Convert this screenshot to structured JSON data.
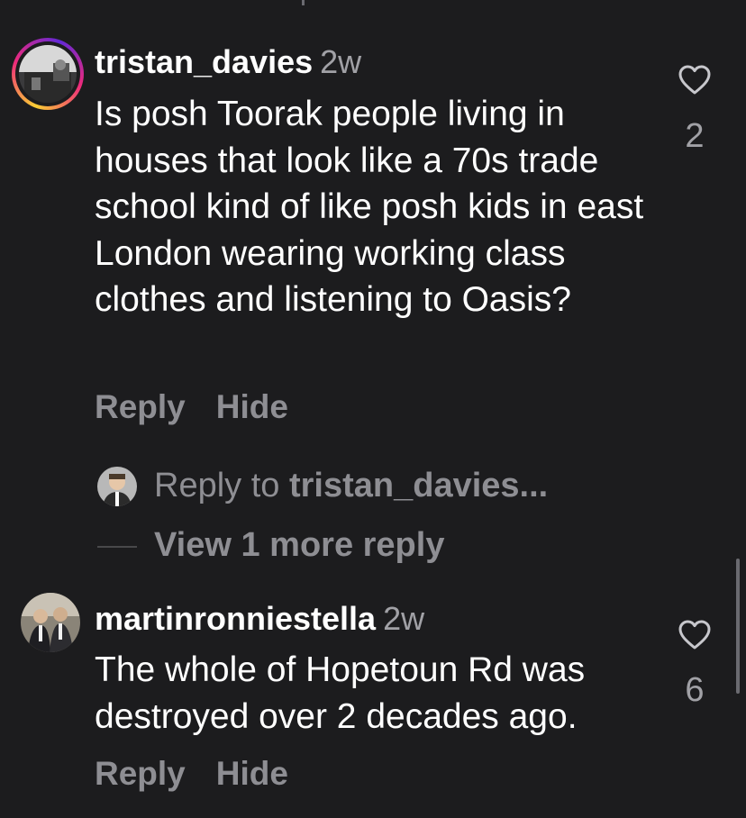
{
  "comments": [
    {
      "username": "tristan_davies",
      "time": "2w",
      "text": "Is posh Toorak people living in houses that look like a 70s trade school kind of like posh kids in east London wearing working class clothes and listening to Oasis?",
      "likes": "2",
      "actions": {
        "reply": "Reply",
        "hide": "Hide"
      },
      "replies": {
        "reply_prefix": "Reply to ",
        "reply_target": "tristan_davies...",
        "view_more": "View 1 more reply"
      }
    },
    {
      "username": "martinronniestella",
      "time": "2w",
      "text": "The whole of Hopetoun Rd was destroyed over 2 decades ago.",
      "likes": "6",
      "actions": {
        "reply": "Reply",
        "hide": "Hide"
      }
    }
  ],
  "icons": {
    "like": "heart-outline-icon",
    "story_ring": "story-ring-gradient"
  },
  "colors": {
    "background": "#1c1c1e",
    "primary_text": "#ffffff",
    "secondary_text": "#8e8e93",
    "timestamp": "#a1a1a6"
  }
}
